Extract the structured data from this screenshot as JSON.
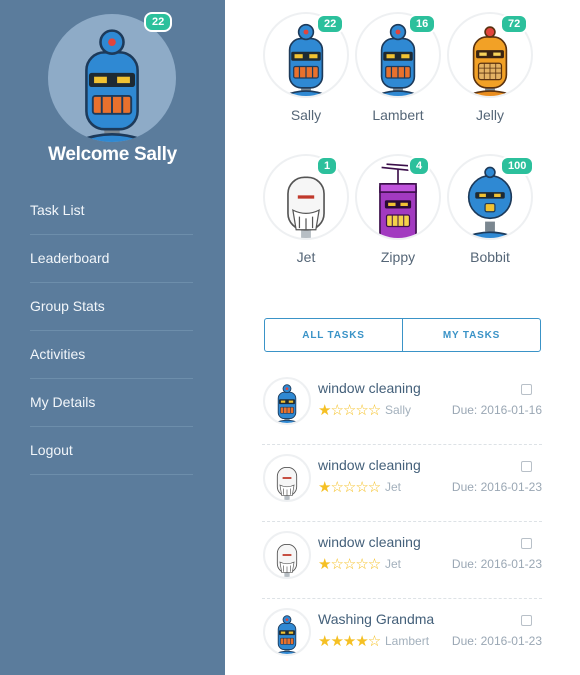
{
  "sidebar": {
    "profile": {
      "badge": "22",
      "welcome": "Welcome Sally"
    },
    "nav": [
      "Task List",
      "Leaderboard",
      "Group Stats",
      "Activities",
      "My Details",
      "Logout"
    ]
  },
  "users": [
    {
      "name": "Sally",
      "badge": "22",
      "robot": "blue-robot"
    },
    {
      "name": "Lambert",
      "badge": "16",
      "robot": "blue-robot-wide"
    },
    {
      "name": "Jelly",
      "badge": "72",
      "robot": "orange-robot"
    },
    {
      "name": "Jet",
      "badge": "1",
      "robot": "white-robot"
    },
    {
      "name": "Zippy",
      "badge": "4",
      "robot": "purple-robot"
    },
    {
      "name": "Bobbit",
      "badge": "100",
      "robot": "blue-round-robot"
    }
  ],
  "tabs": {
    "all": "ALL TASKS",
    "mine": "MY TASKS"
  },
  "tasks": [
    {
      "title": "window cleaning",
      "stars": "★☆☆☆☆",
      "assignee": "Sally",
      "due": "Due: 2016-01-16"
    },
    {
      "title": "window cleaning",
      "stars": "★☆☆☆☆",
      "assignee": "Jet",
      "due": "Due: 2016-01-23"
    },
    {
      "title": "window cleaning",
      "stars": "★☆☆☆☆",
      "assignee": "Jet",
      "due": "Due: 2016-01-23"
    },
    {
      "title": "Washing Grandma",
      "stars": "★★★★☆",
      "assignee": "Lambert",
      "due": "Due: 2016-01-23"
    }
  ],
  "colors": {
    "sidebar": "#5b7c9c",
    "badge": "#2cc09c",
    "accent": "#3a93c7",
    "star": "#f5c024"
  }
}
